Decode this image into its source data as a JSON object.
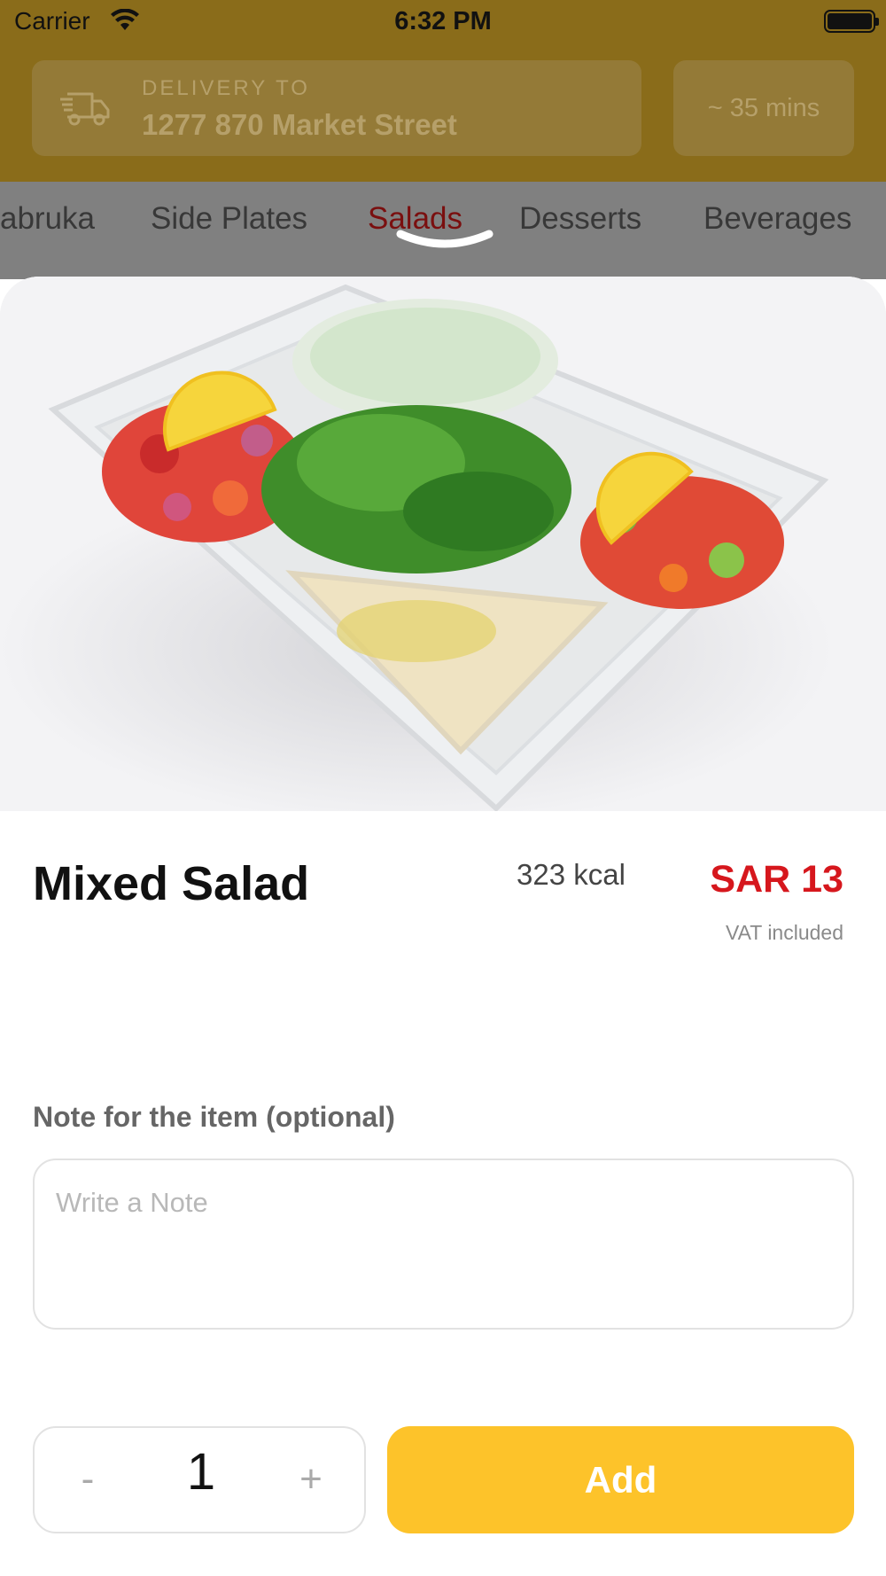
{
  "status_bar": {
    "carrier": "Carrier",
    "time": "6:32 PM"
  },
  "header": {
    "delivery_label": "DELIVERY TO",
    "delivery_address": "1277 870 Market Street",
    "eta": "~ 35 mins"
  },
  "tabs": [
    {
      "label": "abruka",
      "active": false
    },
    {
      "label": "Side Plates",
      "active": false
    },
    {
      "label": "Salads",
      "active": true
    },
    {
      "label": "Desserts",
      "active": false
    },
    {
      "label": "Beverages",
      "active": false
    }
  ],
  "item": {
    "name": "Mixed Salad",
    "kcal": "323 kcal",
    "price": "SAR 13",
    "vat_note": "VAT included"
  },
  "note": {
    "label": "Note for the item (optional)",
    "placeholder": "Write a Note",
    "value": ""
  },
  "quantity": {
    "minus": "-",
    "value": "1",
    "plus": "+"
  },
  "add_button": {
    "label": "Add"
  },
  "colors": {
    "accent": "#fdc32a",
    "price": "#d6171d",
    "active_tab": "#7a0f0f"
  }
}
